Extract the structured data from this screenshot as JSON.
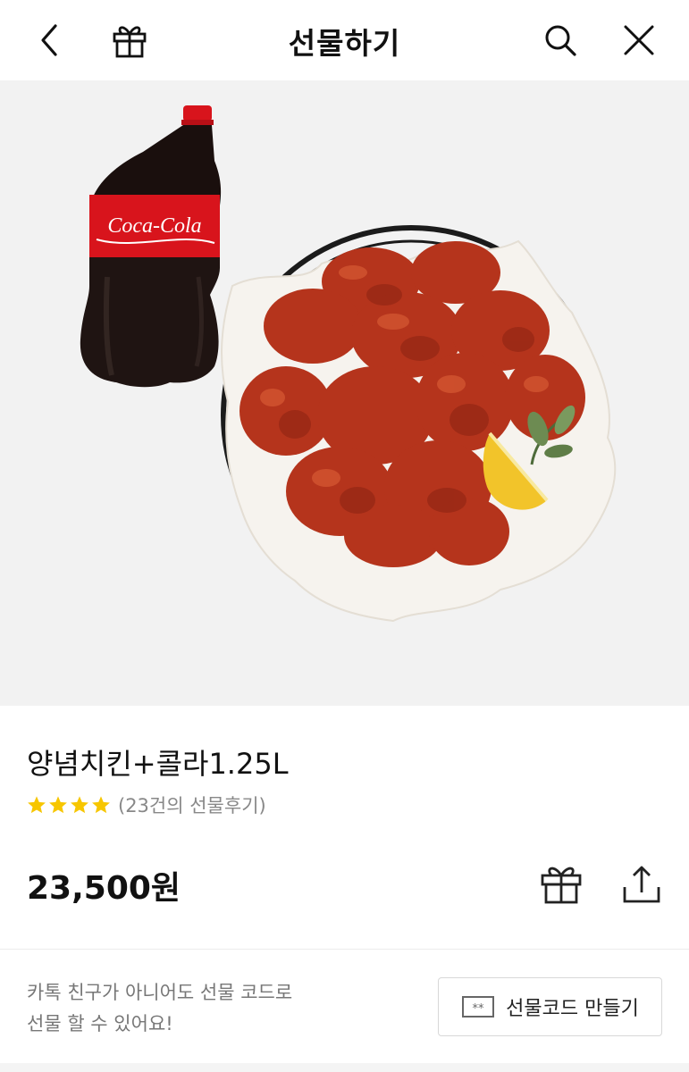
{
  "header": {
    "title": "선물하기",
    "icons": {
      "back": "chevron-left-icon",
      "gift": "gift-icon",
      "search": "search-icon",
      "close": "close-icon"
    }
  },
  "product": {
    "name": "양념치킨+콜라1.25L",
    "rating_stars": 4,
    "review_count_text": "(23건의 선물후기)",
    "price": "23,500원",
    "image_labels": {
      "bottle_brand": "Coca-Cola"
    }
  },
  "actions": {
    "gift_icon": "gift-icon",
    "share_icon": "share-icon"
  },
  "gift_code": {
    "description_line1": "카톡 친구가 아니어도 선물 코드로",
    "description_line2": "선물 할 수 있어요!",
    "button_label": "선물코드 만들기",
    "button_icon": "code-ticket-icon"
  },
  "colors": {
    "star": "#f7c600",
    "sauce": "#b5341c",
    "coke_red": "#d8141c",
    "background": "#f2f2f2"
  }
}
